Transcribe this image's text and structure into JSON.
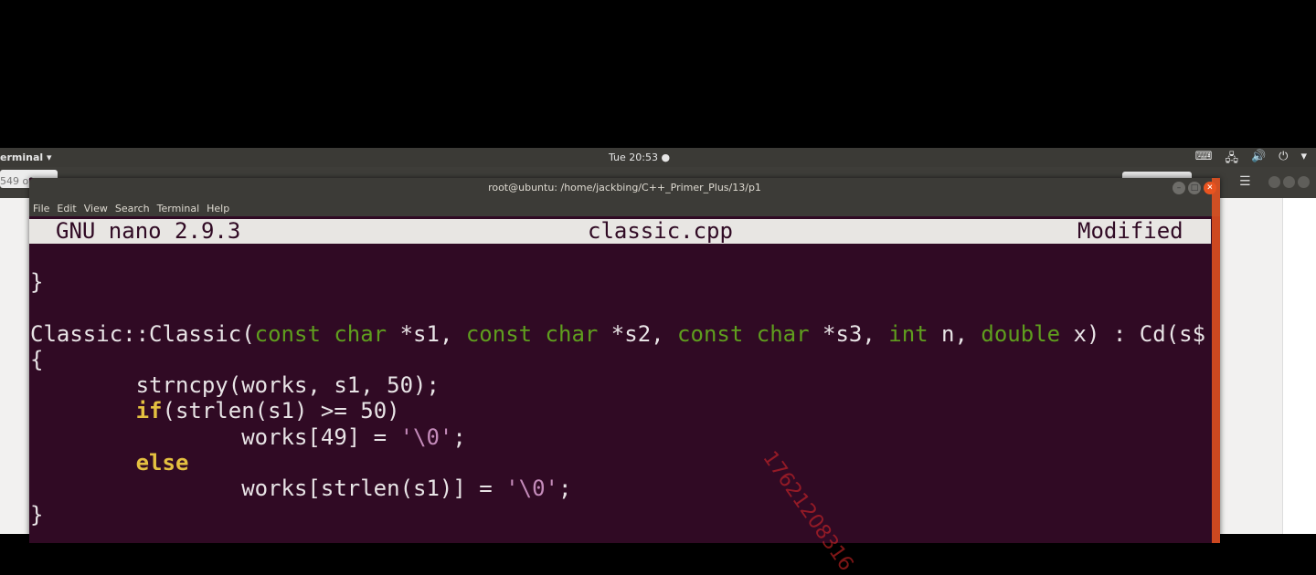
{
  "topbar": {
    "app_menu": "erminal ▾",
    "clock": "Tue 20:53 ●",
    "tray_icons": [
      "keyboard-icon",
      "network-icon",
      "volume-icon",
      "power-icon",
      "chevron-down-icon"
    ]
  },
  "background_window": {
    "tab_text": "549 of"
  },
  "terminal": {
    "title": "root@ubuntu: /home/jackbing/C++_Primer_Plus/13/p1",
    "menu": [
      "File",
      "Edit",
      "View",
      "Search",
      "Terminal",
      "Help"
    ],
    "nano": {
      "version": "GNU nano 2.9.3",
      "filename": "classic.cpp",
      "status": "Modified"
    },
    "code_lines": [
      [
        {
          "t": "}",
          "c": ""
        }
      ],
      [
        {
          "t": "",
          "c": ""
        }
      ],
      [
        {
          "t": "Classic::Classic(",
          "c": ""
        },
        {
          "t": "const char",
          "c": "kw"
        },
        {
          "t": " *s1, ",
          "c": ""
        },
        {
          "t": "const char",
          "c": "kw"
        },
        {
          "t": " *s2, ",
          "c": ""
        },
        {
          "t": "const char",
          "c": "kw"
        },
        {
          "t": " *s3, ",
          "c": ""
        },
        {
          "t": "int",
          "c": "kw"
        },
        {
          "t": " n, ",
          "c": ""
        },
        {
          "t": "double",
          "c": "kw"
        },
        {
          "t": " x) : Cd(s$",
          "c": ""
        }
      ],
      [
        {
          "t": "{",
          "c": ""
        }
      ],
      [
        {
          "t": "        strncpy(works, s1, 50);",
          "c": ""
        }
      ],
      [
        {
          "t": "        ",
          "c": ""
        },
        {
          "t": "if",
          "c": "ctl"
        },
        {
          "t": "(strlen(s1) >= 50)",
          "c": ""
        }
      ],
      [
        {
          "t": "                works[49] = ",
          "c": ""
        },
        {
          "t": "'\\0'",
          "c": "str"
        },
        {
          "t": ";",
          "c": ""
        }
      ],
      [
        {
          "t": "        ",
          "c": ""
        },
        {
          "t": "else",
          "c": "ctl"
        }
      ],
      [
        {
          "t": "                works[strlen(s1)] = ",
          "c": ""
        },
        {
          "t": "'\\0'",
          "c": "str"
        },
        {
          "t": ";",
          "c": ""
        }
      ],
      [
        {
          "t": "}",
          "c": ""
        }
      ]
    ]
  },
  "watermark": "17621208316"
}
